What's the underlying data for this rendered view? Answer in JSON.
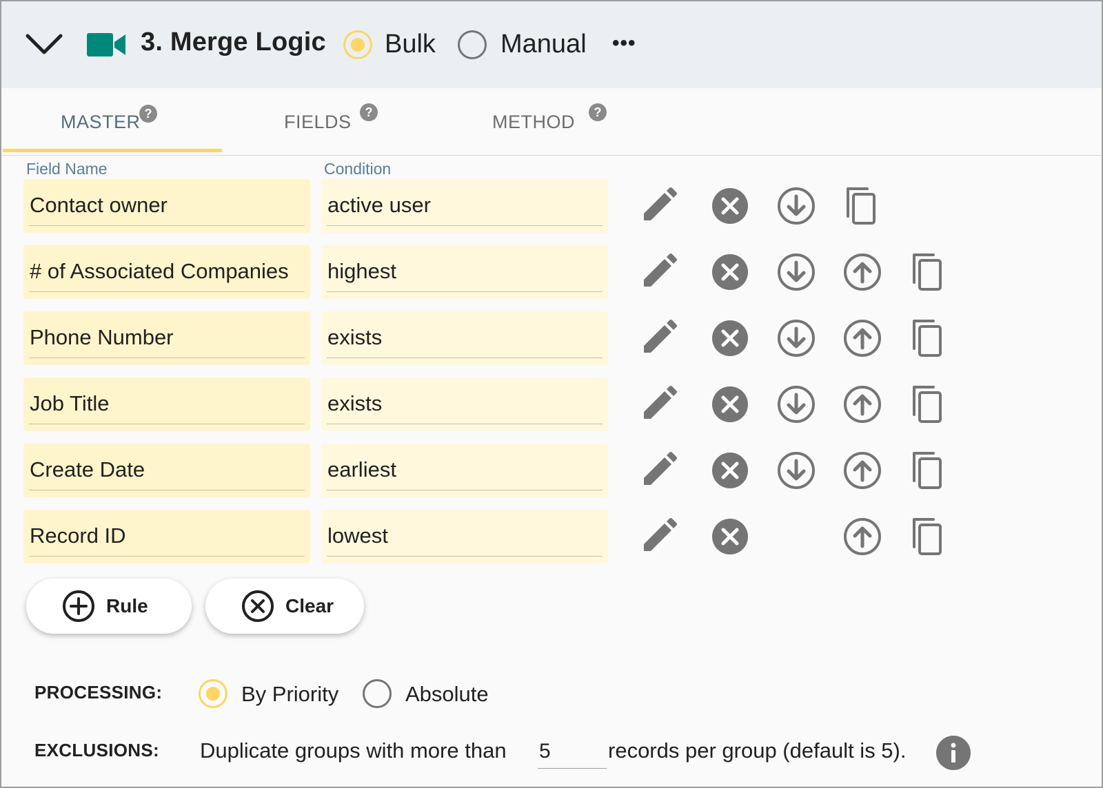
{
  "header": {
    "title": "3. Merge Logic",
    "mode_options": [
      {
        "label": "Bulk",
        "selected": true
      },
      {
        "label": "Manual",
        "selected": false
      }
    ],
    "more_label": "•••"
  },
  "tabs": [
    {
      "label": "MASTER",
      "active": true
    },
    {
      "label": "FIELDS",
      "active": false
    },
    {
      "label": "METHOD",
      "active": false
    }
  ],
  "columns": {
    "field_name": "Field Name",
    "condition": "Condition"
  },
  "rules": [
    {
      "field": "Contact owner",
      "condition": "active user",
      "move_down": true,
      "move_up": false
    },
    {
      "field": "# of Associated Companies",
      "condition": "highest",
      "move_down": true,
      "move_up": true
    },
    {
      "field": "Phone Number",
      "condition": "exists",
      "move_down": true,
      "move_up": true
    },
    {
      "field": "Job Title",
      "condition": "exists",
      "move_down": true,
      "move_up": true
    },
    {
      "field": "Create Date",
      "condition": "earliest",
      "move_down": true,
      "move_up": true
    },
    {
      "field": "Record ID",
      "condition": "lowest",
      "move_down": false,
      "move_up": true
    }
  ],
  "buttons": {
    "add_rule": "Rule",
    "clear": "Clear"
  },
  "processing": {
    "label": "PROCESSING:",
    "options": [
      {
        "label": "By Priority",
        "selected": true
      },
      {
        "label": "Absolute",
        "selected": false
      }
    ]
  },
  "exclusions": {
    "label": "EXCLUSIONS:",
    "text_before": "Duplicate groups with more than",
    "value": "5",
    "text_after": "records per group (default is 5)."
  },
  "colors": {
    "accent": "#fdd663",
    "header_bg": "#eceff1",
    "field_bg": "#fff5cc",
    "condition_bg": "#fff8dd",
    "brand_icon": "#00897b",
    "icon_gray": "#757575"
  }
}
